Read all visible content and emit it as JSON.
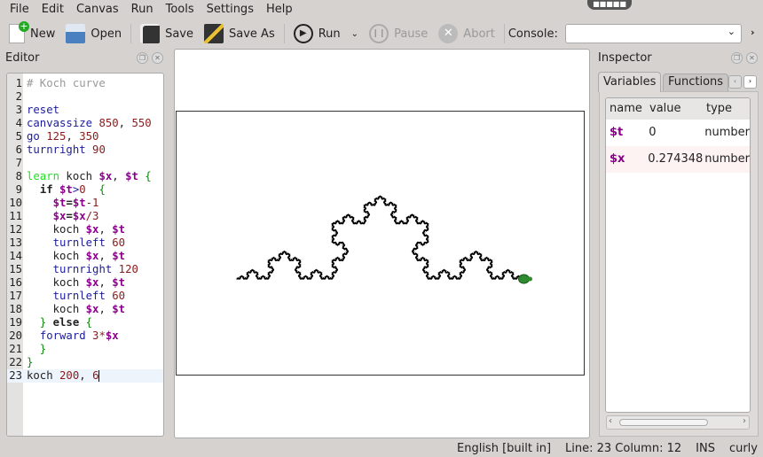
{
  "menu": [
    "File",
    "Edit",
    "Canvas",
    "Run",
    "Tools",
    "Settings",
    "Help"
  ],
  "toolbar": {
    "new": "New",
    "open": "Open",
    "save": "Save",
    "save_as": "Save As",
    "run": "Run",
    "pause": "Pause",
    "abort": "Abort",
    "console_label": "Console:",
    "console_value": ""
  },
  "editor": {
    "title": "Editor",
    "lines": [
      [
        [
          "cm",
          "# Koch curve"
        ]
      ],
      [],
      [
        [
          "kw",
          "reset"
        ]
      ],
      [
        [
          "kw",
          "canvassize "
        ],
        [
          "num",
          "850"
        ],
        [
          "",
          ","
        ],
        [
          "num",
          " 550"
        ]
      ],
      [
        [
          "kw",
          "go "
        ],
        [
          "num",
          "125"
        ],
        [
          "",
          ", "
        ],
        [
          "num",
          "350"
        ]
      ],
      [
        [
          "kw",
          "turnright "
        ],
        [
          "num",
          "90"
        ]
      ],
      [],
      [
        [
          "learn",
          "learn"
        ],
        [
          "",
          " koch "
        ],
        [
          "var",
          "$x"
        ],
        [
          "",
          ", "
        ],
        [
          "var",
          "$t"
        ],
        [
          "br",
          " {"
        ]
      ],
      [
        [
          "",
          "  "
        ],
        [
          "bold",
          "if "
        ],
        [
          "var",
          "$t"
        ],
        [
          "kw",
          ">"
        ],
        [
          "num",
          "0"
        ],
        [
          "br",
          "  {"
        ]
      ],
      [
        [
          "",
          "    "
        ],
        [
          "var",
          "$t"
        ],
        [
          "bold",
          "="
        ],
        [
          "var",
          "$t"
        ],
        [
          "num",
          "-1"
        ]
      ],
      [
        [
          "",
          "    "
        ],
        [
          "var",
          "$x"
        ],
        [
          "bold",
          "="
        ],
        [
          "var",
          "$x"
        ],
        [
          "num",
          "/3"
        ]
      ],
      [
        [
          "",
          "    koch "
        ],
        [
          "var",
          "$x"
        ],
        [
          "",
          ", "
        ],
        [
          "var",
          "$t"
        ]
      ],
      [
        [
          "",
          "    "
        ],
        [
          "kw",
          "turnleft "
        ],
        [
          "num",
          "60"
        ]
      ],
      [
        [
          "",
          "    koch "
        ],
        [
          "var",
          "$x"
        ],
        [
          "",
          ", "
        ],
        [
          "var",
          "$t"
        ]
      ],
      [
        [
          "",
          "    "
        ],
        [
          "kw",
          "turnright "
        ],
        [
          "num",
          "120"
        ]
      ],
      [
        [
          "",
          "    koch "
        ],
        [
          "var",
          "$x"
        ],
        [
          "",
          ", "
        ],
        [
          "var",
          "$t"
        ]
      ],
      [
        [
          "",
          "    "
        ],
        [
          "kw",
          "turnleft "
        ],
        [
          "num",
          "60"
        ]
      ],
      [
        [
          "",
          "    koch "
        ],
        [
          "var",
          "$x"
        ],
        [
          "",
          ", "
        ],
        [
          "var",
          "$t"
        ]
      ],
      [
        [
          "br",
          "  }"
        ],
        [
          "bold",
          " else "
        ],
        [
          "br",
          "{"
        ]
      ],
      [
        [
          "",
          "  "
        ],
        [
          "kw",
          "forward "
        ],
        [
          "num",
          "3*"
        ],
        [
          "var",
          "$x"
        ]
      ],
      [
        [
          "br",
          "  }"
        ]
      ],
      [
        [
          "br",
          "}"
        ]
      ],
      [
        [
          "",
          "koch "
        ],
        [
          "num",
          "200"
        ],
        [
          "",
          ", "
        ],
        [
          "num",
          "6"
        ]
      ]
    ],
    "current_line": 23
  },
  "canvas": {
    "width": 850,
    "height": 550,
    "start": [
      125,
      350
    ],
    "length": 200,
    "depth": 6,
    "pen_color": "#000000",
    "turtle_color": "#2e8b2e"
  },
  "inspector": {
    "title": "Inspector",
    "tabs": [
      "Variables",
      "Functions"
    ],
    "headers": [
      "name",
      "value",
      "type"
    ],
    "rows": [
      {
        "name": "$t",
        "value": "0",
        "type": "number"
      },
      {
        "name": "$x",
        "value": "0.274348",
        "type": "number"
      }
    ]
  },
  "status": {
    "language": "English [built in]",
    "position": "Line: 23 Column: 12",
    "mode": "INS",
    "style": "curly"
  }
}
